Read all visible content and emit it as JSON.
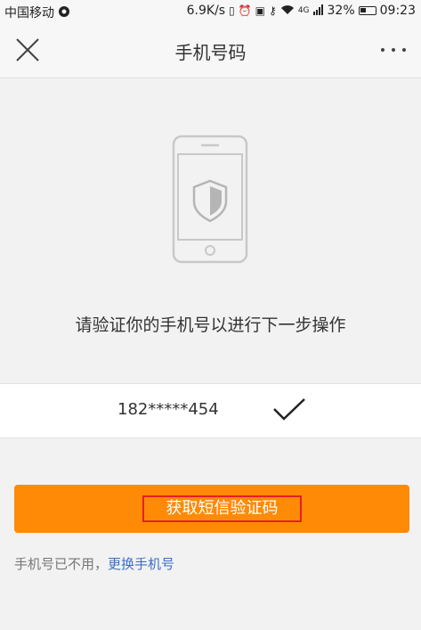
{
  "status_bar": {
    "carrier": "中国移动",
    "speed": "6.9K/s",
    "signal_label": "4G",
    "battery": "32%",
    "time": "09:23"
  },
  "nav": {
    "title": "手机号码",
    "close_icon": "close-icon",
    "more_icon": "more-dots-icon"
  },
  "main": {
    "prompt": "请验证你的手机号以进行下一步操作",
    "phone_number": "182*****454",
    "get_code_label": "获取短信验证码",
    "footer_static": "手机号已不用，",
    "footer_link": "更换手机号"
  },
  "colors": {
    "accent_orange": "#fe8a05",
    "link_blue": "#3d6fc3",
    "highlight_red": "#e2202a"
  }
}
